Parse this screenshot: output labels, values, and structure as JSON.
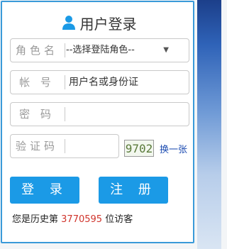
{
  "header": {
    "title": "用户登录",
    "icon": "user-icon"
  },
  "form": {
    "role": {
      "label": "角色名",
      "value": "--选择登陆角色--"
    },
    "username": {
      "label": "帐 号",
      "placeholder": "用户名或身份证"
    },
    "password": {
      "label": "密 码",
      "value": ""
    },
    "captcha": {
      "label": "验证码",
      "value": "",
      "code": "9702",
      "refresh_label": "换一张"
    }
  },
  "buttons": {
    "login": "登 录",
    "register": "注 册"
  },
  "footer": {
    "prefix": "您是历史第",
    "count": "3770595",
    "suffix": "位访客"
  },
  "colors": {
    "accent": "#1b9ae6",
    "border": "#3a9ad9",
    "count": "#d0342c"
  }
}
